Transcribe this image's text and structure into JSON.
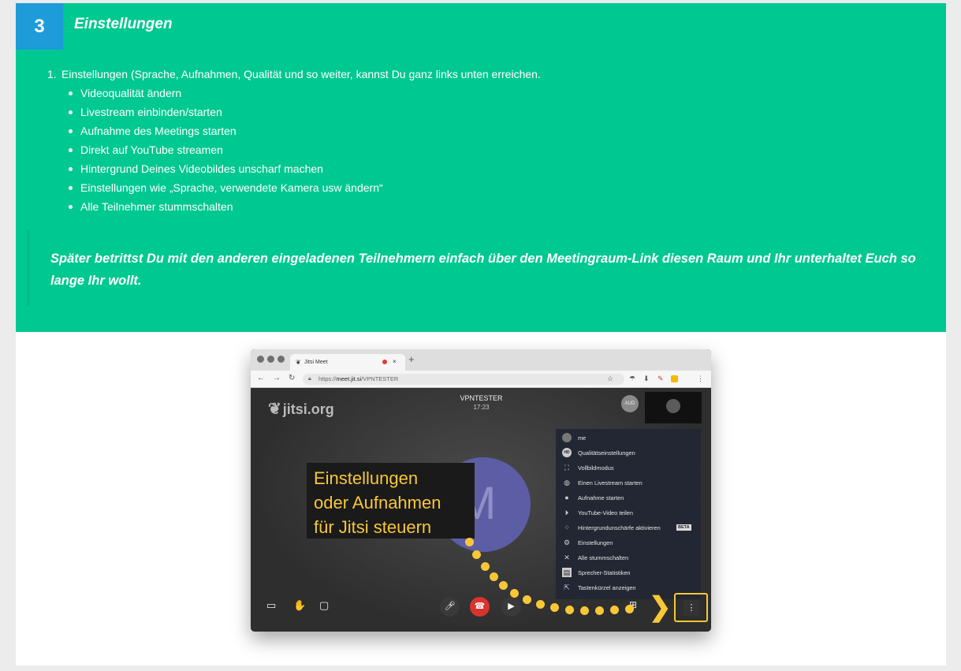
{
  "section": {
    "number": "3",
    "title": "Einstellungen",
    "intro": "Einstellungen (Sprache, Aufnahmen, Qualität und so weiter, kannst Du ganz links unten erreichen.",
    "intro_number": "1.",
    "bullets": [
      "Videoqualität ändern",
      "Livestream einbinden/starten",
      "Aufnahme des Meetings starten",
      "Direkt auf YouTube streamen",
      "Hintergrund Deines Videobildes unscharf machen",
      "Einstellungen wie „Sprache, verwendete Kamera usw ändern“",
      "Alle Teilnehmer stummschalten"
    ],
    "quote": "Später betrittst Du mit den anderen eingeladenen Teilnehmern einfach über den Meetingraum-Link diesen Raum und Ihr unterhaltet Euch so lange Ihr wollt."
  },
  "screenshot": {
    "tab_title": "Jitsi Meet",
    "url_prefix": "https://",
    "url_host": "meet.jit.si",
    "url_path": "/VPNTESTER",
    "logo": "jitsi.org",
    "room_name": "VPNTESTER",
    "room_time": "17:23",
    "aud_label": "AUD",
    "avatar_letter": "M",
    "callout_lines": [
      "Einstellungen",
      "oder Aufnahmen",
      "für Jitsi steuern"
    ],
    "menu": [
      {
        "icon": "user-icon",
        "label": "me"
      },
      {
        "icon": "hd-icon",
        "label": "Qualitätseinstellungen"
      },
      {
        "icon": "fullscreen-icon",
        "label": "Vollbildmodus"
      },
      {
        "icon": "globe-icon",
        "label": "Einen Livestream starten"
      },
      {
        "icon": "record-icon",
        "label": "Aufnahme starten"
      },
      {
        "icon": "play-icon",
        "label": "YouTube-Video teilen"
      },
      {
        "icon": "blur-icon",
        "label": "Hintergrundunschärfe aktivieren",
        "badge": "BETA"
      },
      {
        "icon": "gear-icon",
        "label": "Einstellungen"
      },
      {
        "icon": "mute-all-icon",
        "label": "Alle stummschalten"
      },
      {
        "icon": "stats-icon",
        "label": "Sprecher-Statistiken"
      },
      {
        "icon": "shortcut-icon",
        "label": "Tastenkürzel anzeigen"
      }
    ]
  },
  "colors": {
    "green": "#00c891",
    "blue": "#1e9bd9",
    "yellow": "#f7c738"
  }
}
